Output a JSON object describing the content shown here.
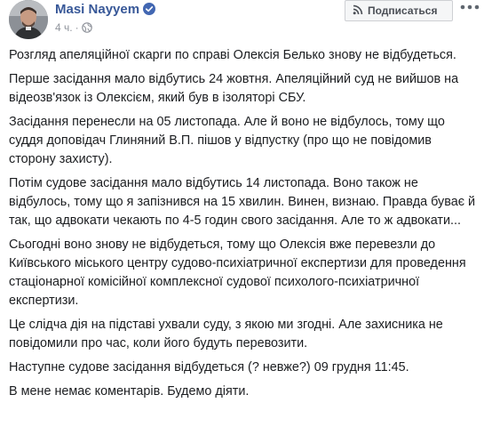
{
  "post": {
    "author": "Masi Nayyem",
    "time": "4 ч.",
    "dot": "·",
    "subscribe_label": "Подписаться",
    "paragraphs": [
      "Розгляд апеляційної скарги по справі Олексія Белько знову не відбудеться.",
      "Перше засідання мало відбутись 24 жовтня. Апеляційний суд не вийшов на відеозв'язок із Олексієм, який був в ізоляторі СБУ.",
      "Засідання перенесли на 05 листопада. Але й воно не відбулось, тому що суддя доповідач Глиняний В.П. пішов у відпустку (про що не повідомив сторону захисту).",
      "Потім судове засідання мало відбутись 14 листопада. Воно також не відбулось, тому що я запізнився на 15 хвилин. Винен, визнаю. Правда буває й так, що адвокати чекають по 4-5 годин свого засідання. Але то ж адвокати...",
      "Сьогодні воно знову не відбудеться, тому що Олексія вже перевезли до Київського міського центру судово-психіатричної експертизи для проведення стаціонарної комісійної комплексної судової психолого-психіатричної експертизи.",
      "Це слідча дія на підставі ухвали суду, з якою ми згодні. Але захисника не повідомили про час, коли його будуть перевозити.",
      "Наступне судове засідання відбудеться (? невже?) 09 грудня 11:45.",
      "В мене немає коментарів. Будемо діяти."
    ]
  },
  "colors": {
    "author": "#385898",
    "meta": "#90949c",
    "text": "#1c1e21",
    "button_bg": "#f5f6f7",
    "button_border": "#ced0d4",
    "verified": "#4267b2"
  },
  "icons": {
    "verified": "verified-badge-icon",
    "audience": "globe-icon",
    "subscribe": "rss-icon",
    "more": "more-options-icon"
  }
}
